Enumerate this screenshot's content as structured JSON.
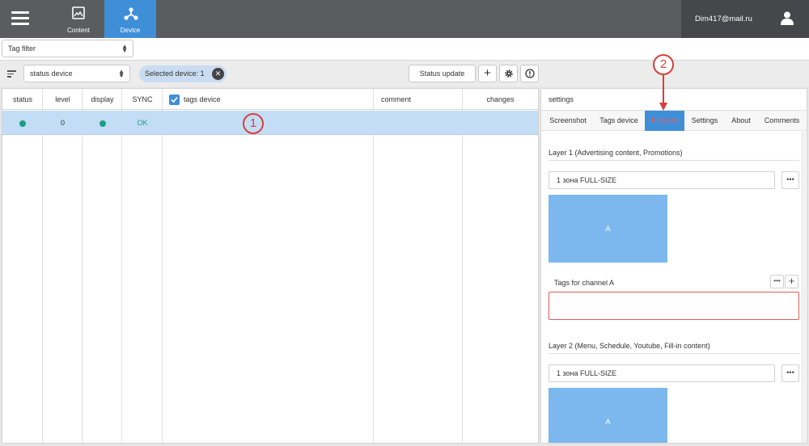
{
  "header": {
    "nav": [
      {
        "label": "Content",
        "icon": "image-icon"
      },
      {
        "label": "Device",
        "icon": "device-network-icon"
      }
    ],
    "user_email": "Dim417@mail.ru"
  },
  "filter": {
    "tag_filter": "Tag filter"
  },
  "toolbar": {
    "status_select": "status device",
    "chip_label": "Selected device: 1",
    "status_update": "Status update",
    "plus": "+"
  },
  "table": {
    "headers": {
      "status": "status",
      "level": "level",
      "display": "display",
      "sync": "SYNC",
      "tags": "tags device",
      "comment": "comment",
      "changes": "changes"
    },
    "rows": [
      {
        "level": "0",
        "sync": "OK"
      }
    ]
  },
  "callouts": {
    "one": "1",
    "two": "2"
  },
  "settings": {
    "title": "settings",
    "tabs": [
      "Screenshot",
      "Tags device",
      "Projects",
      "Settings",
      "About",
      "Comments"
    ],
    "active_tab": "Projects",
    "layer1": {
      "title": "Layer 1 (Advertising content, Promotions)",
      "zone": "1 зона FULL-SIZE",
      "preview": "A",
      "tags_label": "Tags for channel A"
    },
    "layer2": {
      "title": "Layer 2 (Menu, Schedule, Youtube, Fill-in content)",
      "zone": "1 зона FULL-SIZE",
      "preview": "A"
    },
    "dots": "•••"
  },
  "colors": {
    "topbar": "#5a5c60",
    "accent": "#3f8fd8",
    "status_ok": "#1aa07d",
    "callout": "#d9403a",
    "selected_row": "#c3ddf6"
  }
}
